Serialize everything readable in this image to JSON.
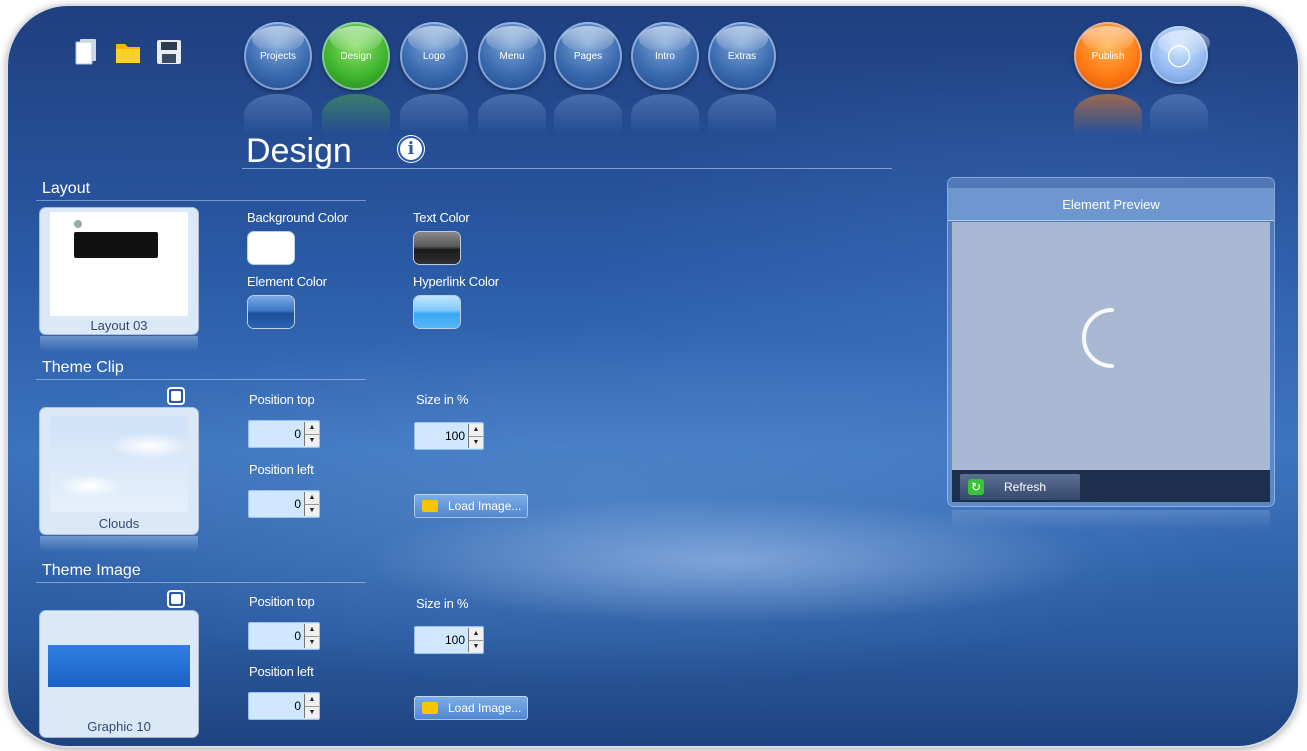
{
  "nav": {
    "items": [
      {
        "label": "Projects",
        "active": false
      },
      {
        "label": "Design",
        "active": true
      },
      {
        "label": "Logo",
        "active": false
      },
      {
        "label": "Menu",
        "active": false
      },
      {
        "label": "Pages",
        "active": false
      },
      {
        "label": "Intro",
        "active": false
      },
      {
        "label": "Extras",
        "active": false
      }
    ],
    "publish_label": "Publish"
  },
  "toolbar_icons": [
    "new-file-icon",
    "open-folder-icon",
    "save-icon",
    "lightbulb-icon"
  ],
  "page": {
    "title": "Design"
  },
  "layout": {
    "section_title": "Layout",
    "thumbnail_label": "Layout 03",
    "background_color_label": "Background Color",
    "text_color_label": "Text Color",
    "element_color_label": "Element Color",
    "hyperlink_color_label": "Hyperlink Color"
  },
  "theme_clip": {
    "section_title": "Theme Clip",
    "thumbnail_label": "Clouds",
    "position_top_label": "Position top",
    "position_top_value": "0",
    "position_left_label": "Position left",
    "position_left_value": "0",
    "size_label": "Size in %",
    "size_value": "100",
    "load_label": "Load Image..."
  },
  "theme_image": {
    "section_title": "Theme Image",
    "thumbnail_label": "Graphic 10",
    "position_top_label": "Position top",
    "position_top_value": "0",
    "position_left_label": "Position left",
    "position_left_value": "0",
    "size_label": "Size in %",
    "size_value": "100",
    "load_label": "Load Image..."
  },
  "preview": {
    "title": "Element Preview",
    "refresh_label": "Refresh"
  },
  "colors": {
    "accent_green": "#3fb52d",
    "publish_orange": "#ff7a14",
    "background_color": "#ffffff",
    "text_color": "#3a3a3a",
    "element_color": "#2a63b3",
    "hyperlink_color": "#4ab0f5"
  }
}
